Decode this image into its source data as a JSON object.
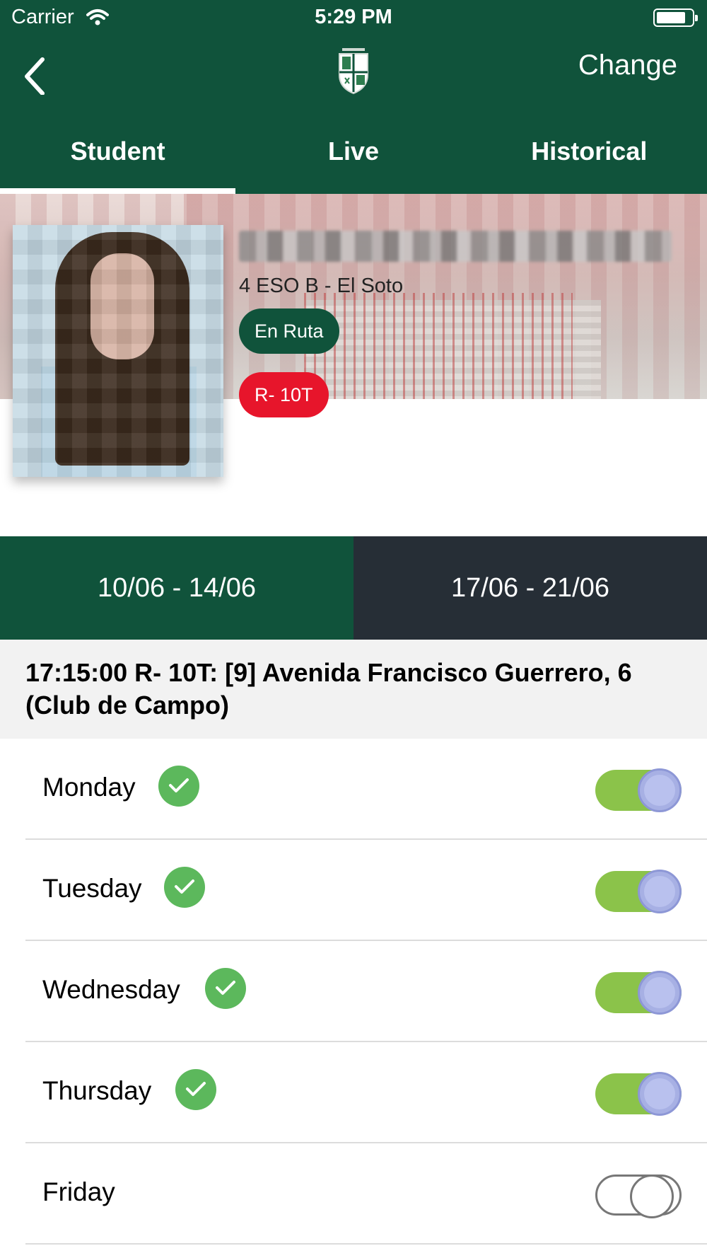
{
  "status_bar": {
    "carrier": "Carrier",
    "time": "5:29 PM"
  },
  "nav": {
    "change_label": "Change",
    "logo_icon": "school-crest-icon",
    "back_icon": "chevron-left-icon"
  },
  "tabs": [
    {
      "label": "Student",
      "active": true
    },
    {
      "label": "Live",
      "active": false
    },
    {
      "label": "Historical",
      "active": false
    }
  ],
  "student": {
    "class_label": "4 ESO B - El Soto",
    "status_badge": "En Ruta",
    "route_badge": "R- 10T"
  },
  "weeks": [
    {
      "label": "10/06 - 14/06",
      "active": true
    },
    {
      "label": "17/06 - 21/06",
      "active": false
    }
  ],
  "stop": {
    "header": "17:15:00 R- 10T: [9] Avenida Francisco Guerrero, 6 (Club de Campo)"
  },
  "days": [
    {
      "label": "Monday",
      "checked": true,
      "enabled": true
    },
    {
      "label": "Tuesday",
      "checked": true,
      "enabled": true
    },
    {
      "label": "Wednesday",
      "checked": true,
      "enabled": true
    },
    {
      "label": "Thursday",
      "checked": true,
      "enabled": true
    },
    {
      "label": "Friday",
      "checked": false,
      "enabled": false
    }
  ],
  "colors": {
    "primary": "#10533b",
    "dark": "#262e36",
    "route_red": "#e7152b",
    "check_green": "#5cb85c",
    "toggle_on": "#8bc34a"
  }
}
